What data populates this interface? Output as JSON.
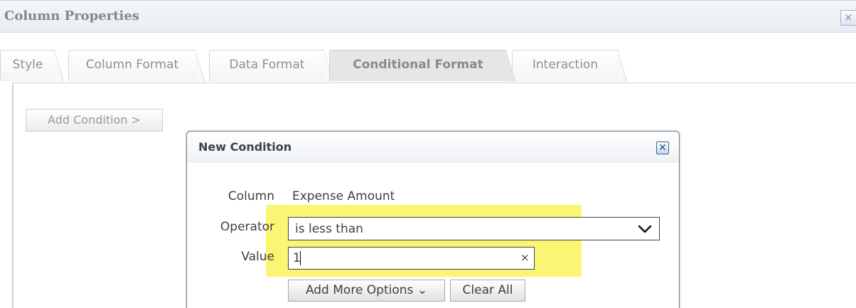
{
  "window": {
    "title": "Column Properties",
    "close_glyph": "✕"
  },
  "tabs": [
    {
      "label": "Style"
    },
    {
      "label": "Column Format"
    },
    {
      "label": "Data Format"
    },
    {
      "label": "Conditional Format",
      "active": true
    },
    {
      "label": "Interaction"
    }
  ],
  "panel": {
    "add_condition_label": "Add Condition >"
  },
  "dialog": {
    "title": "New Condition",
    "close_glyph": "✕",
    "column_label": "Column",
    "column_value": "Expense Amount",
    "operator_label": "Operator",
    "operator_value": "is less than",
    "value_label": "Value",
    "value_value": "1",
    "value_clear_glyph": "×",
    "add_more_options_label": "Add More Options",
    "add_more_options_chevron": "⌄",
    "clear_all_label": "Clear All"
  },
  "colors": {
    "highlight": "#f9f35a",
    "active_tab_bg": "#e6e6e6",
    "dialog_close_accent": "#1d4e8f"
  },
  "icons": {
    "outer_close": "close-icon",
    "dialog_close": "close-icon",
    "operator_dropdown": "chevron-down-icon",
    "value_clear": "clear-icon"
  }
}
